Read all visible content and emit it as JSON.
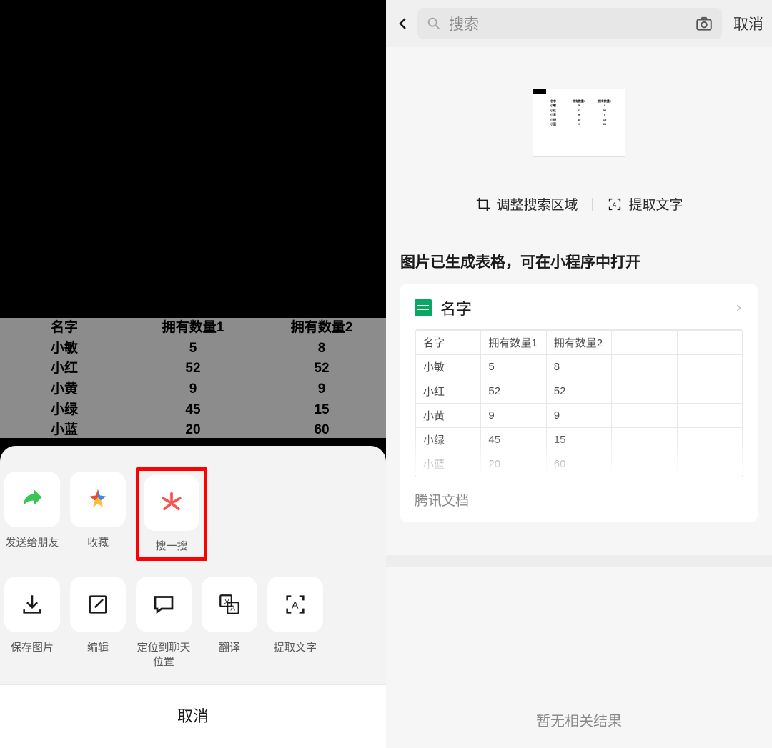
{
  "left": {
    "table": {
      "headers": [
        "名字",
        "拥有数量1",
        "拥有数量2"
      ],
      "rows": [
        [
          "小敏",
          "5",
          "8"
        ],
        [
          "小红",
          "52",
          "52"
        ],
        [
          "小黄",
          "9",
          "9"
        ],
        [
          "小绿",
          "45",
          "15"
        ],
        [
          "小蓝",
          "20",
          "60"
        ]
      ]
    },
    "share": {
      "row1": [
        {
          "label": "发送给朋友",
          "icon": "share-icon"
        },
        {
          "label": "收藏",
          "icon": "favorite-icon"
        },
        {
          "label": "搜一搜",
          "icon": "search-spark-icon"
        }
      ],
      "row2": [
        {
          "label": "保存图片",
          "icon": "download-icon"
        },
        {
          "label": "编辑",
          "icon": "edit-icon"
        },
        {
          "label": "定位到聊天位置",
          "icon": "chat-icon"
        },
        {
          "label": "翻译",
          "icon": "translate-icon"
        },
        {
          "label": "提取文字",
          "icon": "ocr-icon"
        }
      ],
      "cancel": "取消"
    }
  },
  "right": {
    "search_placeholder": "搜索",
    "cancel": "取消",
    "tool_crop": "调整搜索区域",
    "tool_ocr": "提取文字",
    "heading": "图片已生成表格，可在小程序中打开",
    "card_title": "名字",
    "card_foot": "腾讯文档",
    "table": {
      "headers": [
        "名字",
        "拥有数量1",
        "拥有数量2",
        "",
        ""
      ],
      "rows": [
        [
          "小敏",
          "5",
          "8",
          "",
          ""
        ],
        [
          "小红",
          "52",
          "52",
          "",
          ""
        ],
        [
          "小黄",
          "9",
          "9",
          "",
          ""
        ],
        [
          "小绿",
          "45",
          "15",
          "",
          ""
        ],
        [
          "小蓝",
          "20",
          "60",
          "",
          ""
        ]
      ]
    },
    "no_result": "暂无相关结果"
  }
}
